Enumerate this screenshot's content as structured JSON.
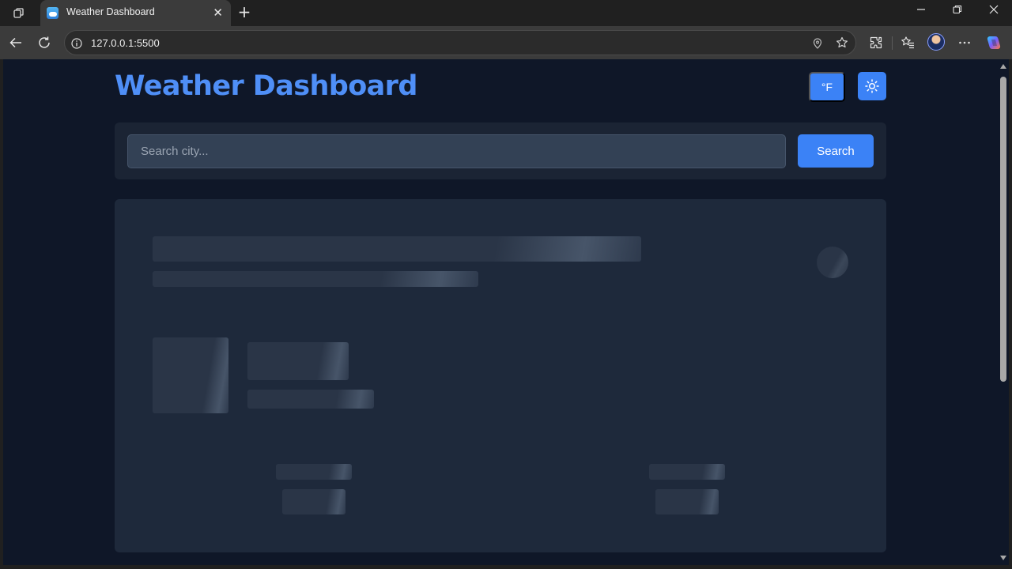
{
  "browser": {
    "tab_title": "Weather Dashboard",
    "url": "127.0.0.1:5500"
  },
  "app": {
    "title": "Weather Dashboard",
    "unit_toggle_label": "°F",
    "theme_icon": "sun-icon"
  },
  "search": {
    "placeholder": "Search city...",
    "button_label": "Search"
  },
  "colors": {
    "accent": "#3b82f6",
    "title": "#4f8ff7",
    "background": "#0f1728",
    "card": "#1e293b"
  }
}
